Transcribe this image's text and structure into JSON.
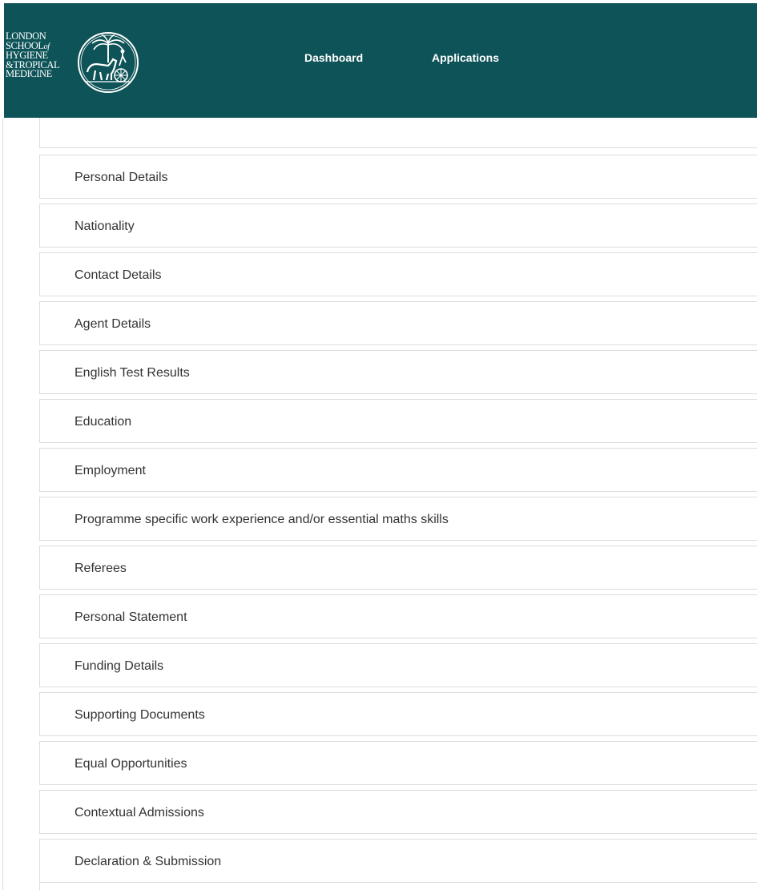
{
  "header": {
    "logo": {
      "line1": "LONDON",
      "line2": "SCHOOL",
      "line2_suffix": "of",
      "line3": "HYGIENE",
      "line4": "&TROPICAL",
      "line5": "MEDICINE",
      "emblem_icon": "horse-chariot-emblem-icon"
    },
    "background_color": "#0e5357",
    "nav": {
      "dashboard": "Dashboard",
      "applications": "Applications"
    }
  },
  "sections": [
    {
      "label": "Personal Details"
    },
    {
      "label": "Nationality"
    },
    {
      "label": "Contact Details"
    },
    {
      "label": "Agent Details"
    },
    {
      "label": "English Test Results"
    },
    {
      "label": "Education"
    },
    {
      "label": "Employment"
    },
    {
      "label": "Programme specific work experience and/or essential maths skills"
    },
    {
      "label": "Referees"
    },
    {
      "label": "Personal Statement"
    },
    {
      "label": "Funding Details"
    },
    {
      "label": "Supporting Documents"
    },
    {
      "label": "Equal Opportunities"
    },
    {
      "label": "Contextual Admissions"
    },
    {
      "label": "Declaration & Submission"
    }
  ]
}
